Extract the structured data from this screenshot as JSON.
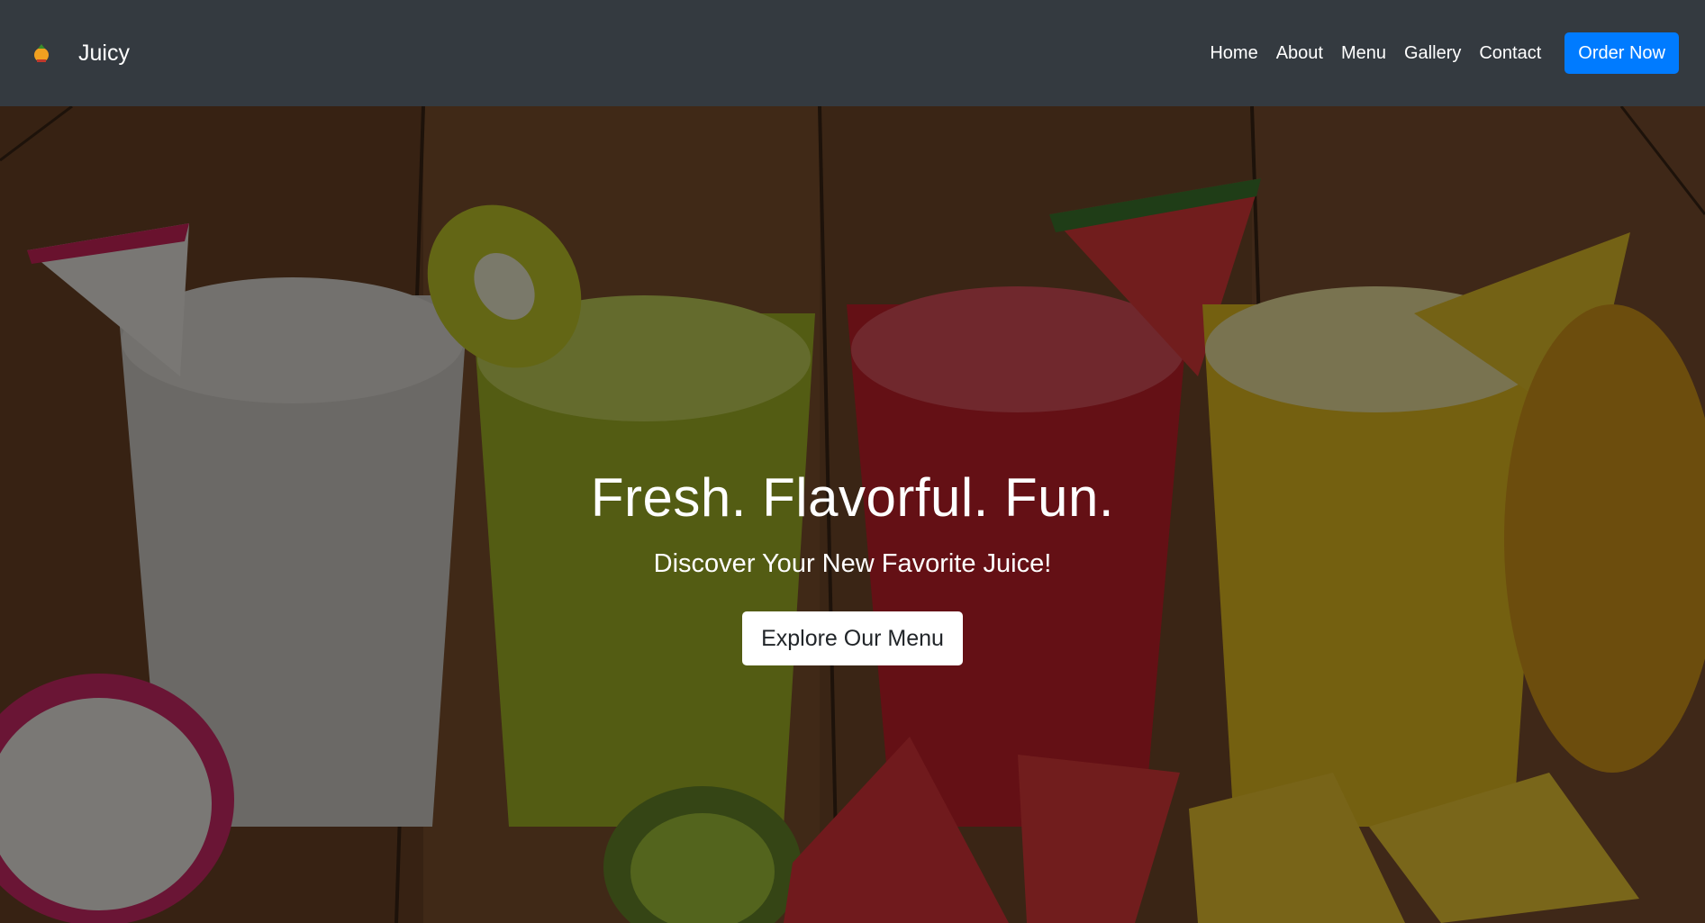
{
  "navbar": {
    "brand_name": "Juicy",
    "logo_icon": "juice-logo-icon",
    "links": [
      "Home",
      "About",
      "Menu",
      "Gallery",
      "Contact"
    ],
    "order_button": "Order Now"
  },
  "hero": {
    "title": "Fresh. Flavorful. Fun.",
    "subtitle": "Discover Your New Favorite Juice!",
    "cta_button": "Explore Our Menu",
    "background_image": "juice-glasses-photo"
  },
  "colors": {
    "navbar_bg": "#343a40",
    "accent": "#007bff",
    "text_light": "#ffffff"
  }
}
